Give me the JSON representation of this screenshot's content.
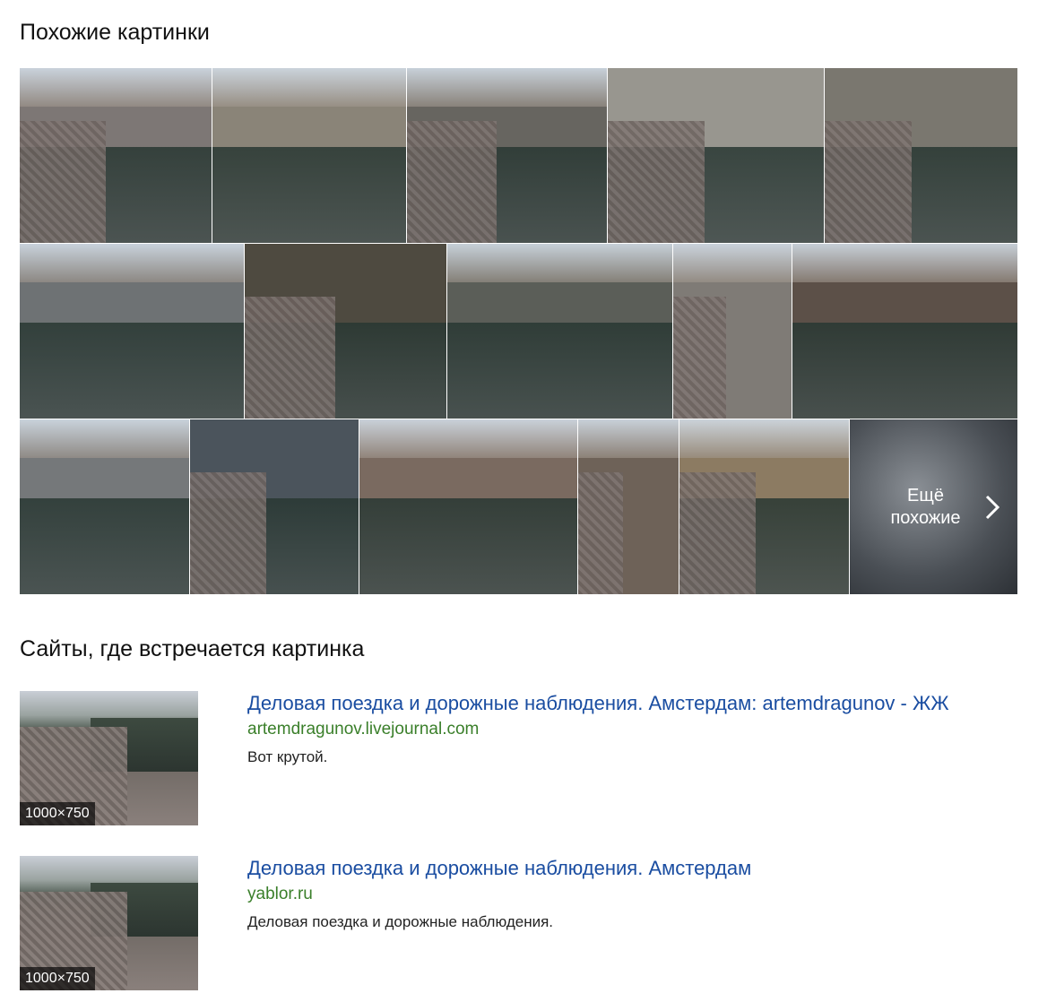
{
  "similar": {
    "title": "Похожие картинки",
    "rows": [
      [
        {
          "name": "similar-image-1",
          "color": "#7d7775"
        },
        {
          "name": "similar-image-2",
          "color": "#8a8478"
        },
        {
          "name": "similar-image-3",
          "color": "#676560"
        },
        {
          "name": "similar-image-4",
          "color": "#98968f"
        },
        {
          "name": "similar-image-5",
          "color": "#7a776f"
        }
      ],
      [
        {
          "name": "similar-image-6",
          "color": "#6e7274"
        },
        {
          "name": "similar-image-7",
          "color": "#4e4a40"
        },
        {
          "name": "similar-image-8",
          "color": "#5b5e58"
        },
        {
          "name": "similar-image-9",
          "color": "#7f7b76"
        },
        {
          "name": "similar-image-10",
          "color": "#5c5048"
        }
      ],
      [
        {
          "name": "similar-image-11",
          "color": "#75787a"
        },
        {
          "name": "similar-image-12",
          "color": "#4b545c"
        },
        {
          "name": "similar-image-13",
          "color": "#7a6a60"
        },
        {
          "name": "similar-image-14",
          "color": "#6e6258"
        },
        {
          "name": "similar-image-15",
          "color": "#8c7b62"
        }
      ]
    ],
    "more_label_line1": "Ещё",
    "more_label_line2": "похожие"
  },
  "sites": {
    "title": "Сайты, где встречается картинка",
    "results": [
      {
        "title": "Деловая поездка и дорожные наблюдения. Амстердам: artemdragunov - ЖЖ",
        "url": "artemdragunov.livejournal.com",
        "snippet": "Вот крутой.",
        "size": "1000×750"
      },
      {
        "title": "Деловая поездка и дорожные наблюдения. Амстердам",
        "url": "yablor.ru",
        "snippet": "Деловая поездка и дорожные наблюдения.",
        "size": "1000×750"
      }
    ]
  },
  "colors": {
    "link": "#1a4da1",
    "url": "#3a7f2a"
  }
}
